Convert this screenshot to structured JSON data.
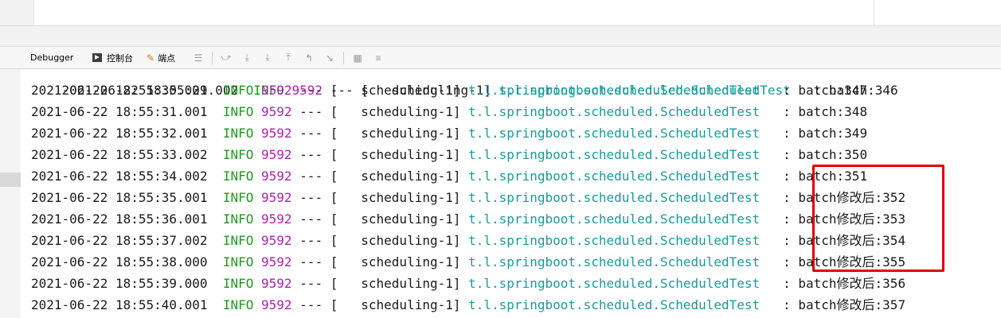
{
  "toolbar": {
    "debugger_label": "Debugger",
    "console_label": "控制台",
    "breakpoints_label": "端点"
  },
  "console": {
    "partial_line": {
      "timestamp": "2021-06-22 18:55:29.002",
      "level": "INFO",
      "pid": "9592",
      "sep": "---",
      "bracket": "[",
      "thread": "scheduling-1]",
      "logger": "t.l.springboot.scheduled.ScheduledTest",
      "colon": ":",
      "message": "batch:346"
    },
    "lines": [
      {
        "timestamp": "2021-06-22 18:55:30.001",
        "level": "INFO",
        "pid": "9592",
        "sep": "---",
        "bracket": "[",
        "thread": "scheduling-1]",
        "logger": "t.l.springboot.scheduled.ScheduledTest",
        "colon": ":",
        "message": "batch:347"
      },
      {
        "timestamp": "2021-06-22 18:55:31.001",
        "level": "INFO",
        "pid": "9592",
        "sep": "---",
        "bracket": "[",
        "thread": "scheduling-1]",
        "logger": "t.l.springboot.scheduled.ScheduledTest",
        "colon": ":",
        "message": "batch:348"
      },
      {
        "timestamp": "2021-06-22 18:55:32.001",
        "level": "INFO",
        "pid": "9592",
        "sep": "---",
        "bracket": "[",
        "thread": "scheduling-1]",
        "logger": "t.l.springboot.scheduled.ScheduledTest",
        "colon": ":",
        "message": "batch:349"
      },
      {
        "timestamp": "2021-06-22 18:55:33.002",
        "level": "INFO",
        "pid": "9592",
        "sep": "---",
        "bracket": "[",
        "thread": "scheduling-1]",
        "logger": "t.l.springboot.scheduled.ScheduledTest",
        "colon": ":",
        "message": "batch:350"
      },
      {
        "timestamp": "2021-06-22 18:55:34.002",
        "level": "INFO",
        "pid": "9592",
        "sep": "---",
        "bracket": "[",
        "thread": "scheduling-1]",
        "logger": "t.l.springboot.scheduled.ScheduledTest",
        "colon": ":",
        "message": "batch:351"
      },
      {
        "timestamp": "2021-06-22 18:55:35.001",
        "level": "INFO",
        "pid": "9592",
        "sep": "---",
        "bracket": "[",
        "thread": "scheduling-1]",
        "logger": "t.l.springboot.scheduled.ScheduledTest",
        "colon": ":",
        "message": "batch修改后:352"
      },
      {
        "timestamp": "2021-06-22 18:55:36.001",
        "level": "INFO",
        "pid": "9592",
        "sep": "---",
        "bracket": "[",
        "thread": "scheduling-1]",
        "logger": "t.l.springboot.scheduled.ScheduledTest",
        "colon": ":",
        "message": "batch修改后:353"
      },
      {
        "timestamp": "2021-06-22 18:55:37.002",
        "level": "INFO",
        "pid": "9592",
        "sep": "---",
        "bracket": "[",
        "thread": "scheduling-1]",
        "logger": "t.l.springboot.scheduled.ScheduledTest",
        "colon": ":",
        "message": "batch修改后:354"
      },
      {
        "timestamp": "2021-06-22 18:55:38.000",
        "level": "INFO",
        "pid": "9592",
        "sep": "---",
        "bracket": "[",
        "thread": "scheduling-1]",
        "logger": "t.l.springboot.scheduled.ScheduledTest",
        "colon": ":",
        "message": "batch修改后:355"
      },
      {
        "timestamp": "2021-06-22 18:55:39.000",
        "level": "INFO",
        "pid": "9592",
        "sep": "---",
        "bracket": "[",
        "thread": "scheduling-1]",
        "logger": "t.l.springboot.scheduled.ScheduledTest",
        "colon": ":",
        "message": "batch修改后:356"
      },
      {
        "timestamp": "2021-06-22 18:55:40.001",
        "level": "INFO",
        "pid": "9592",
        "sep": "---",
        "bracket": "[",
        "thread": "scheduling-1]",
        "logger": "t.l.springboot.scheduled.ScheduledTest",
        "colon": ":",
        "message": "batch修改后:357"
      }
    ]
  },
  "colors": {
    "level": "#1e9a1e",
    "pid": "#b01fb0",
    "logger": "#1a9a9a",
    "highlight": "#e00000"
  }
}
